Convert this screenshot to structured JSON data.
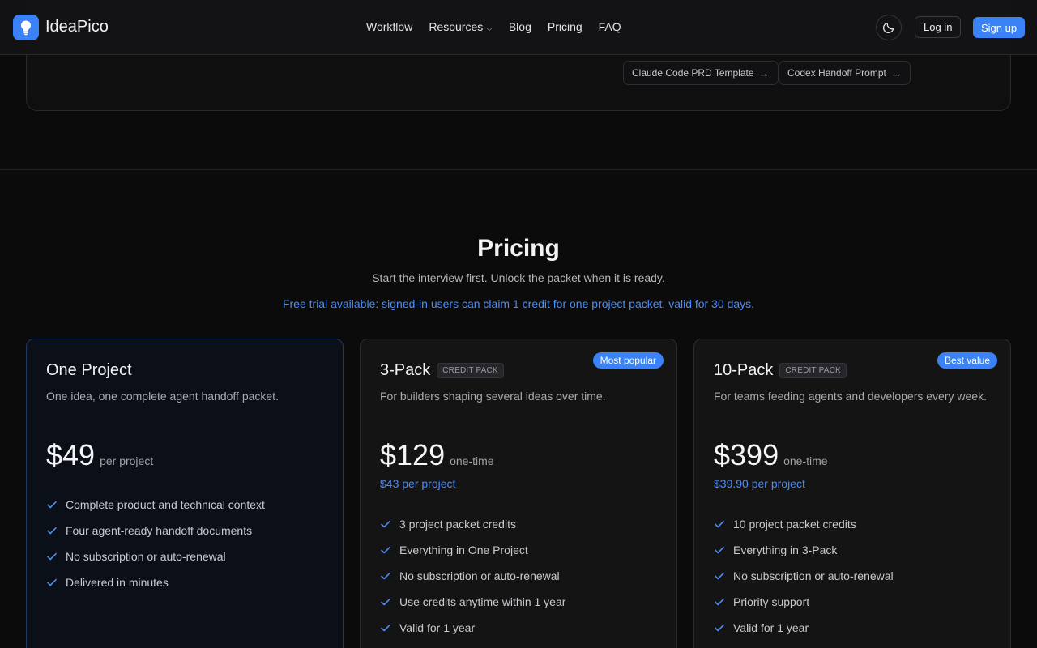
{
  "nav": {
    "brand": "IdeaPico",
    "links": [
      "Workflow",
      "Resources",
      "Blog",
      "Pricing",
      "FAQ"
    ],
    "login": "Log in",
    "signup": "Sign up"
  },
  "template_links": [
    {
      "label": "Claude Code PRD Template"
    },
    {
      "label": "Codex Handoff Prompt"
    }
  ],
  "pricing": {
    "title": "Pricing",
    "subtitle": "Start the interview first. Unlock the packet when it is ready.",
    "trial": "Free trial available: signed-in users can claim 1 credit for one project packet, valid for 30 days.",
    "plans": [
      {
        "name": "One Project",
        "description": "One idea, one complete agent handoff packet.",
        "price": "$49",
        "unit": "per project",
        "features": [
          "Complete product and technical context",
          "Four agent-ready handoff documents",
          "No subscription or auto-renewal",
          "Delivered in minutes"
        ]
      },
      {
        "name": "3-Pack",
        "tag": "CREDIT PACK",
        "badge": "Most popular",
        "description": "For builders shaping several ideas over time.",
        "price": "$129",
        "unit": "one-time",
        "per_project": "$43 per project",
        "features": [
          "3 project packet credits",
          "Everything in One Project",
          "No subscription or auto-renewal",
          "Use credits anytime within 1 year",
          "Valid for 1 year"
        ]
      },
      {
        "name": "10-Pack",
        "tag": "CREDIT PACK",
        "badge": "Best value",
        "description": "For teams feeding agents and developers every week.",
        "price": "$399",
        "unit": "one-time",
        "per_project": "$39.90 per project",
        "features": [
          "10 project packet credits",
          "Everything in 3-Pack",
          "No subscription or auto-renewal",
          "Priority support",
          "Valid for 1 year"
        ]
      }
    ]
  },
  "colors": {
    "accent": "#3b82f6",
    "background": "#0b0b0c"
  }
}
